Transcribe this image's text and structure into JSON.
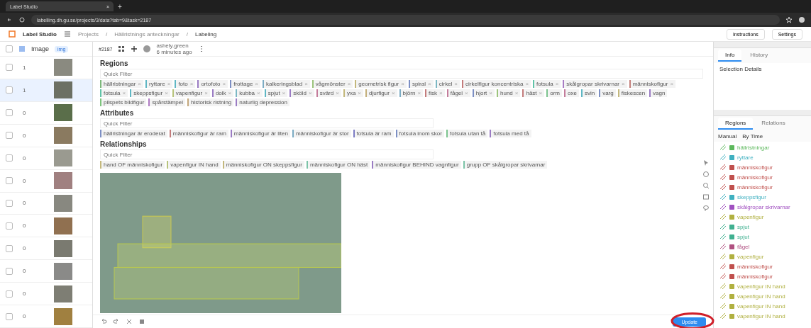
{
  "browser": {
    "tab_title": "Label Studio",
    "close": "×",
    "new_tab": "+",
    "url": "labelling.dh.gu.se/projects/3/data?tab=9&task=2187"
  },
  "header": {
    "app_name": "Label Studio",
    "breadcrumbs": [
      "Projects",
      "Hällristnings anteckningar",
      "Labeling"
    ],
    "separator": "/",
    "buttons": [
      "Instructions",
      "Settings"
    ]
  },
  "task_list": {
    "all_checked": false,
    "column": "Image",
    "toggle": "img",
    "rows": [
      {
        "count": "1",
        "selected": false
      },
      {
        "count": "1",
        "selected": true
      },
      {
        "count": "0",
        "selected": false
      },
      {
        "count": "0",
        "selected": false
      },
      {
        "count": "0",
        "selected": false
      },
      {
        "count": "0",
        "selected": false
      },
      {
        "count": "0",
        "selected": false
      },
      {
        "count": "0",
        "selected": false
      },
      {
        "count": "0",
        "selected": false
      },
      {
        "count": "0",
        "selected": false
      },
      {
        "count": "0",
        "selected": false
      },
      {
        "count": "0",
        "selected": false
      }
    ]
  },
  "toolbar": {
    "task_id": "#2187",
    "user": "ashely.green",
    "time": "6 minutes ago"
  },
  "sections": [
    {
      "title": "Regions",
      "placeholder": "Quick Filter",
      "tags": [
        {
          "label": "hällristningar",
          "close": "×",
          "color": "#7cb87a"
        },
        {
          "label": "ryttare",
          "close": "×",
          "color": "#5fb7c4"
        },
        {
          "label": "foto",
          "close": "×",
          "color": "#5fb7c4"
        },
        {
          "label": "ortofoto",
          "close": "×",
          "color": "#9b7cc4"
        },
        {
          "label": "frottage",
          "close": "×",
          "color": "#7c8fc4"
        },
        {
          "label": "kalkeringsblad",
          "close": "×",
          "color": "#7cacc4"
        },
        {
          "label": "vågmönster",
          "close": "×",
          "color": "#9cc47c"
        },
        {
          "label": "geometrisk figur",
          "close": "×",
          "color": "#c4b87c"
        },
        {
          "label": "spiral",
          "close": "×",
          "color": "#7c8fc4"
        },
        {
          "label": "cirkel",
          "close": "×",
          "color": "#7cb8c4"
        },
        {
          "label": "cirkelfigur koncentriska",
          "close": "×",
          "color": "#c47c7c"
        },
        {
          "label": "fotsula",
          "close": "×",
          "color": "#5fc4a8"
        },
        {
          "label": "skålgropar skrivarnar",
          "close": "×",
          "color": "#a87cc4"
        },
        {
          "label": "människofigur",
          "close": "×",
          "color": "#c4807c"
        },
        {
          "label": "fotsula",
          "close": "×",
          "color": "#5fc4a8"
        },
        {
          "label": "skeppsfigur",
          "close": "×",
          "color": "#5fb7c4"
        },
        {
          "label": "vapenfigur",
          "close": "×",
          "color": "#b8c47c"
        },
        {
          "label": "dolk",
          "close": "×",
          "color": "#9b7cc4"
        },
        {
          "label": "kubba",
          "close": "×",
          "color": "#7cb8c4"
        },
        {
          "label": "spjut",
          "close": "×",
          "color": "#5fb7c4"
        },
        {
          "label": "sköld",
          "close": "×",
          "color": "#9b7cc4"
        },
        {
          "label": "svärd",
          "close": "×",
          "color": "#c47c9b"
        },
        {
          "label": "yxa",
          "close": "×",
          "color": "#c4b87c"
        },
        {
          "label": "djurfigur",
          "close": "×",
          "color": "#c4b07c"
        },
        {
          "label": "björn",
          "close": "×",
          "color": "#7cacc4"
        },
        {
          "label": "fisk",
          "close": "×",
          "color": "#c47c7c"
        },
        {
          "label": "fågel",
          "close": "×",
          "color": "#c47c9b"
        },
        {
          "label": "hjort",
          "close": "×",
          "color": "#7c8fc4"
        },
        {
          "label": "hund",
          "close": "×",
          "color": "#9cc47c"
        },
        {
          "label": "häst",
          "close": "×",
          "color": "#c47c7c"
        },
        {
          "label": "orm",
          "color": "#7cc48f"
        },
        {
          "label": "oxe",
          "color": "#c47c9b"
        },
        {
          "label": "svin",
          "color": "#5fb7c4"
        },
        {
          "label": "varg",
          "color": "#7c8fc4"
        },
        {
          "label": "fiskescen",
          "color": "#c4b87c"
        },
        {
          "label": "vagn",
          "color": "#9b7cc4"
        },
        {
          "label": "pilspets bildfigur",
          "color": "#7cc47c"
        },
        {
          "label": "spårstämpel",
          "color": "#b07cc4"
        },
        {
          "label": "historisk ristning",
          "color": "#c4a87c"
        },
        {
          "label": "naturlig depression",
          "color": "#9b7cc4"
        }
      ]
    },
    {
      "title": "Attributes",
      "placeholder": "Quick Filter",
      "tags": [
        {
          "label": "hällristningar är eroderat",
          "color": "#7c8fc4"
        },
        {
          "label": "människofigur är ram",
          "color": "#c47c7c"
        },
        {
          "label": "människofigur är liten",
          "color": "#9b7cc4"
        },
        {
          "label": "människofigur är stor",
          "color": "#7cacc4"
        },
        {
          "label": "fotsula är ram",
          "color": "#7c7cc4"
        },
        {
          "label": "fotsula inom skor",
          "color": "#7c8fc4"
        },
        {
          "label": "fotsula utan tå",
          "color": "#7cc48f"
        },
        {
          "label": "fotsula med tå",
          "color": "#9b7cc4"
        }
      ]
    },
    {
      "title": "Relationships",
      "placeholder": "Quick Filter",
      "tags": [
        {
          "label": "hand OF människofigur",
          "color": "#c4b87c"
        },
        {
          "label": "vapenfigur IN hand",
          "color": "#b8c47c"
        },
        {
          "label": "människofigur ON skeppsfigur",
          "color": "#c4b87c"
        },
        {
          "label": "människofigur ON häst",
          "color": "#7cc4a8"
        },
        {
          "label": "människofigur BEHIND vagnfigur",
          "color": "#9b7cc4"
        },
        {
          "label": "grupp OF skålgropar skrivarnar",
          "color": "#7cc4a8"
        }
      ]
    }
  ],
  "footer": {
    "submit": "Update"
  },
  "info_panel": {
    "tabs": [
      {
        "label": "Info",
        "selected": true
      },
      {
        "label": "History",
        "selected": false
      }
    ],
    "heading": "Selection Details"
  },
  "regions_panel": {
    "tabs": [
      {
        "label": "Regions",
        "selected": true
      },
      {
        "label": "Relations",
        "selected": false
      }
    ],
    "sort": [
      "Manual",
      "By Time"
    ],
    "items": [
      {
        "label": "hällristningar",
        "color": "#5cb85c"
      },
      {
        "label": "ryttare",
        "color": "#3fb0c0"
      },
      {
        "label": "människofigur",
        "color": "#c0504d"
      },
      {
        "label": "människofigur",
        "color": "#c0504d"
      },
      {
        "label": "människofigur",
        "color": "#c0504d"
      },
      {
        "label": "skeppsfigur",
        "color": "#3fb0c0"
      },
      {
        "label": "skålgropar skrivarnar",
        "color": "#a050c0"
      },
      {
        "label": "vapenfigur",
        "color": "#b0b040"
      },
      {
        "label": "spjut",
        "color": "#40b090"
      },
      {
        "label": "spjut",
        "color": "#40b090"
      },
      {
        "label": "fågel",
        "color": "#b05080"
      },
      {
        "label": "vapenfigur",
        "color": "#b0b040"
      },
      {
        "label": "människofigur",
        "color": "#c0504d"
      },
      {
        "label": "människofigur",
        "color": "#c0504d"
      },
      {
        "label": "vapenfigur IN hand",
        "color": "#b0b040"
      },
      {
        "label": "vapenfigur IN hand",
        "color": "#b0b040"
      },
      {
        "label": "vapenfigur IN hand",
        "color": "#b0b040"
      },
      {
        "label": "vapenfigur IN hand",
        "color": "#b0b040"
      }
    ]
  }
}
